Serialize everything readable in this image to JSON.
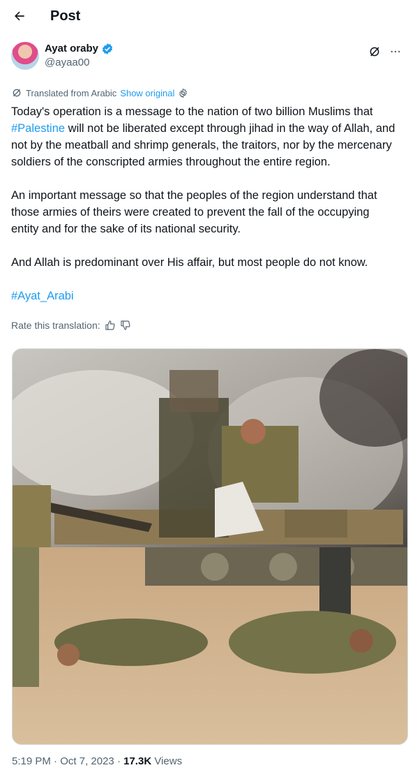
{
  "header": {
    "title": "Post"
  },
  "author": {
    "name": "Ayat oraby",
    "handle": "@ayaa00"
  },
  "translation": {
    "label": "Translated from Arabic",
    "show_original": "Show original",
    "rate_label": "Rate this translation:"
  },
  "post": {
    "p1_before": "Today's operation is a message to the nation of two billion Muslims that ",
    "hashtag1": "#Palestine",
    "p1_after": " will not be liberated except through jihad in the way of Allah, and not by the meatball and shrimp generals, the traitors, nor by the mercenary soldiers of the conscripted armies throughout the entire region.",
    "p2": "An important message so that the peoples of the region understand that those armies of theirs were created to prevent the fall of the occupying entity and for the sake of its national security.",
    "p3": "And Allah is predominant over His affair, but most people do not know.",
    "hashtag2": "#Ayat_Arabi"
  },
  "meta": {
    "time": "5:19 PM",
    "sep": " · ",
    "date": "Oct 7, 2023",
    "dot": " · ",
    "views_count": "17.3K",
    "views_label": " Views"
  },
  "colors": {
    "accent": "#1d9bf0",
    "text": "#0f1419",
    "secondary": "#536471"
  },
  "icons": [
    "back-arrow-icon",
    "verified-badge-icon",
    "grok-icon",
    "more-icon",
    "translate-icon",
    "settings-icon",
    "thumbs-up-icon",
    "thumbs-down-icon"
  ]
}
